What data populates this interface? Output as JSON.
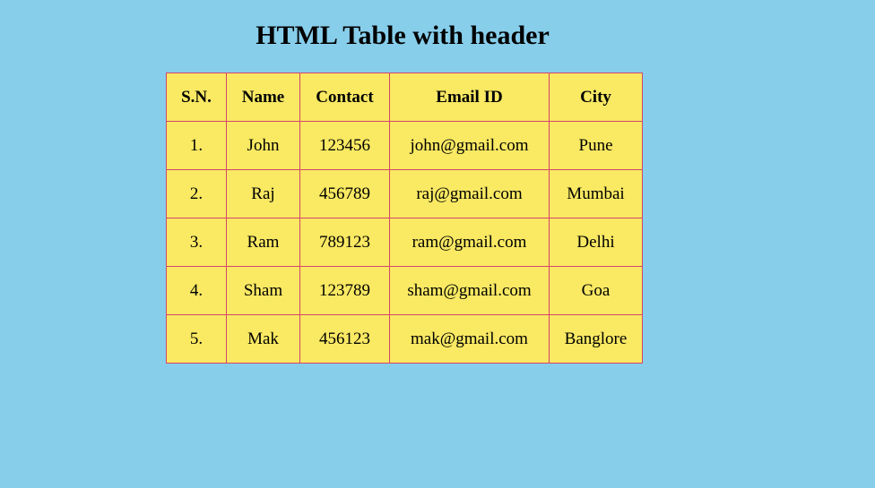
{
  "page": {
    "title": "HTML Table with header"
  },
  "table": {
    "headers": {
      "sn": "S.N.",
      "name": "Name",
      "contact": "Contact",
      "email": "Email ID",
      "city": "City"
    },
    "rows": [
      {
        "sn": "1.",
        "name": "John",
        "contact": "123456",
        "email": "john@gmail.com",
        "city": "Pune"
      },
      {
        "sn": "2.",
        "name": "Raj",
        "contact": "456789",
        "email": "raj@gmail.com",
        "city": "Mumbai"
      },
      {
        "sn": "3.",
        "name": "Ram",
        "contact": "789123",
        "email": "ram@gmail.com",
        "city": "Delhi"
      },
      {
        "sn": "4.",
        "name": "Sham",
        "contact": "123789",
        "email": "sham@gmail.com",
        "city": "Goa"
      },
      {
        "sn": "5.",
        "name": "Mak",
        "contact": "456123",
        "email": "mak@gmail.com",
        "city": "Banglore"
      }
    ]
  },
  "colors": {
    "page_background": "#87ceeb",
    "table_background": "#f9e963",
    "border": "#d4456b"
  }
}
